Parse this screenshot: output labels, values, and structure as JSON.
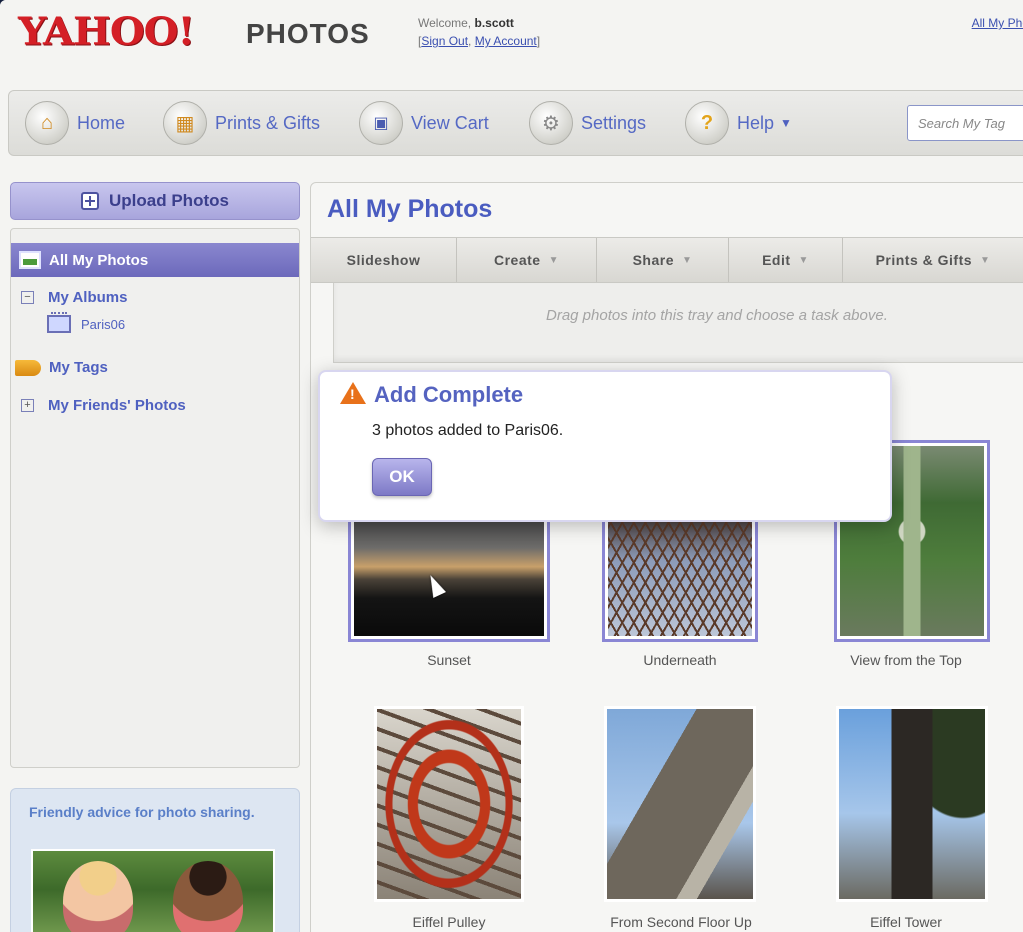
{
  "header": {
    "logo_yahoo": "YAHOO!",
    "logo_photos": "PHOTOS",
    "welcome_prefix": "Welcome,",
    "username": "b.scott",
    "sign_out": "Sign Out",
    "my_account": "My Account",
    "top_link": "All My Pho"
  },
  "nav": {
    "home": "Home",
    "prints_gifts": "Prints & Gifts",
    "view_cart": "View Cart",
    "settings": "Settings",
    "help": "Help",
    "search_placeholder": "Search My Tag"
  },
  "sidebar": {
    "upload": "Upload Photos",
    "all_photos": "All My Photos",
    "my_albums": "My Albums",
    "album_paris": "Paris06",
    "my_tags": "My Tags",
    "friends_photos": "My Friends' Photos",
    "advice": "Friendly advice for photo sharing."
  },
  "main": {
    "title": "All My Photos",
    "toolbar": {
      "slideshow": "Slideshow",
      "create": "Create",
      "share": "Share",
      "edit": "Edit",
      "prints_gifts": "Prints & Gifts"
    },
    "tray_message": "Drag photos into this tray and choose a task above.",
    "photos": [
      {
        "caption": "Sunset"
      },
      {
        "caption": "Underneath"
      },
      {
        "caption": "View from the Top"
      },
      {
        "caption": "Eiffel Pulley"
      },
      {
        "caption": "From Second Floor Up"
      },
      {
        "caption": "Eiffel Tower"
      }
    ]
  },
  "modal": {
    "title": "Add Complete",
    "message": "3 photos added to Paris06.",
    "ok": "OK"
  },
  "colors": {
    "accent": "#5563c0",
    "selected_nav": "#6c69bb",
    "yahoo_red": "#d41f26",
    "warning": "#e8711a"
  }
}
